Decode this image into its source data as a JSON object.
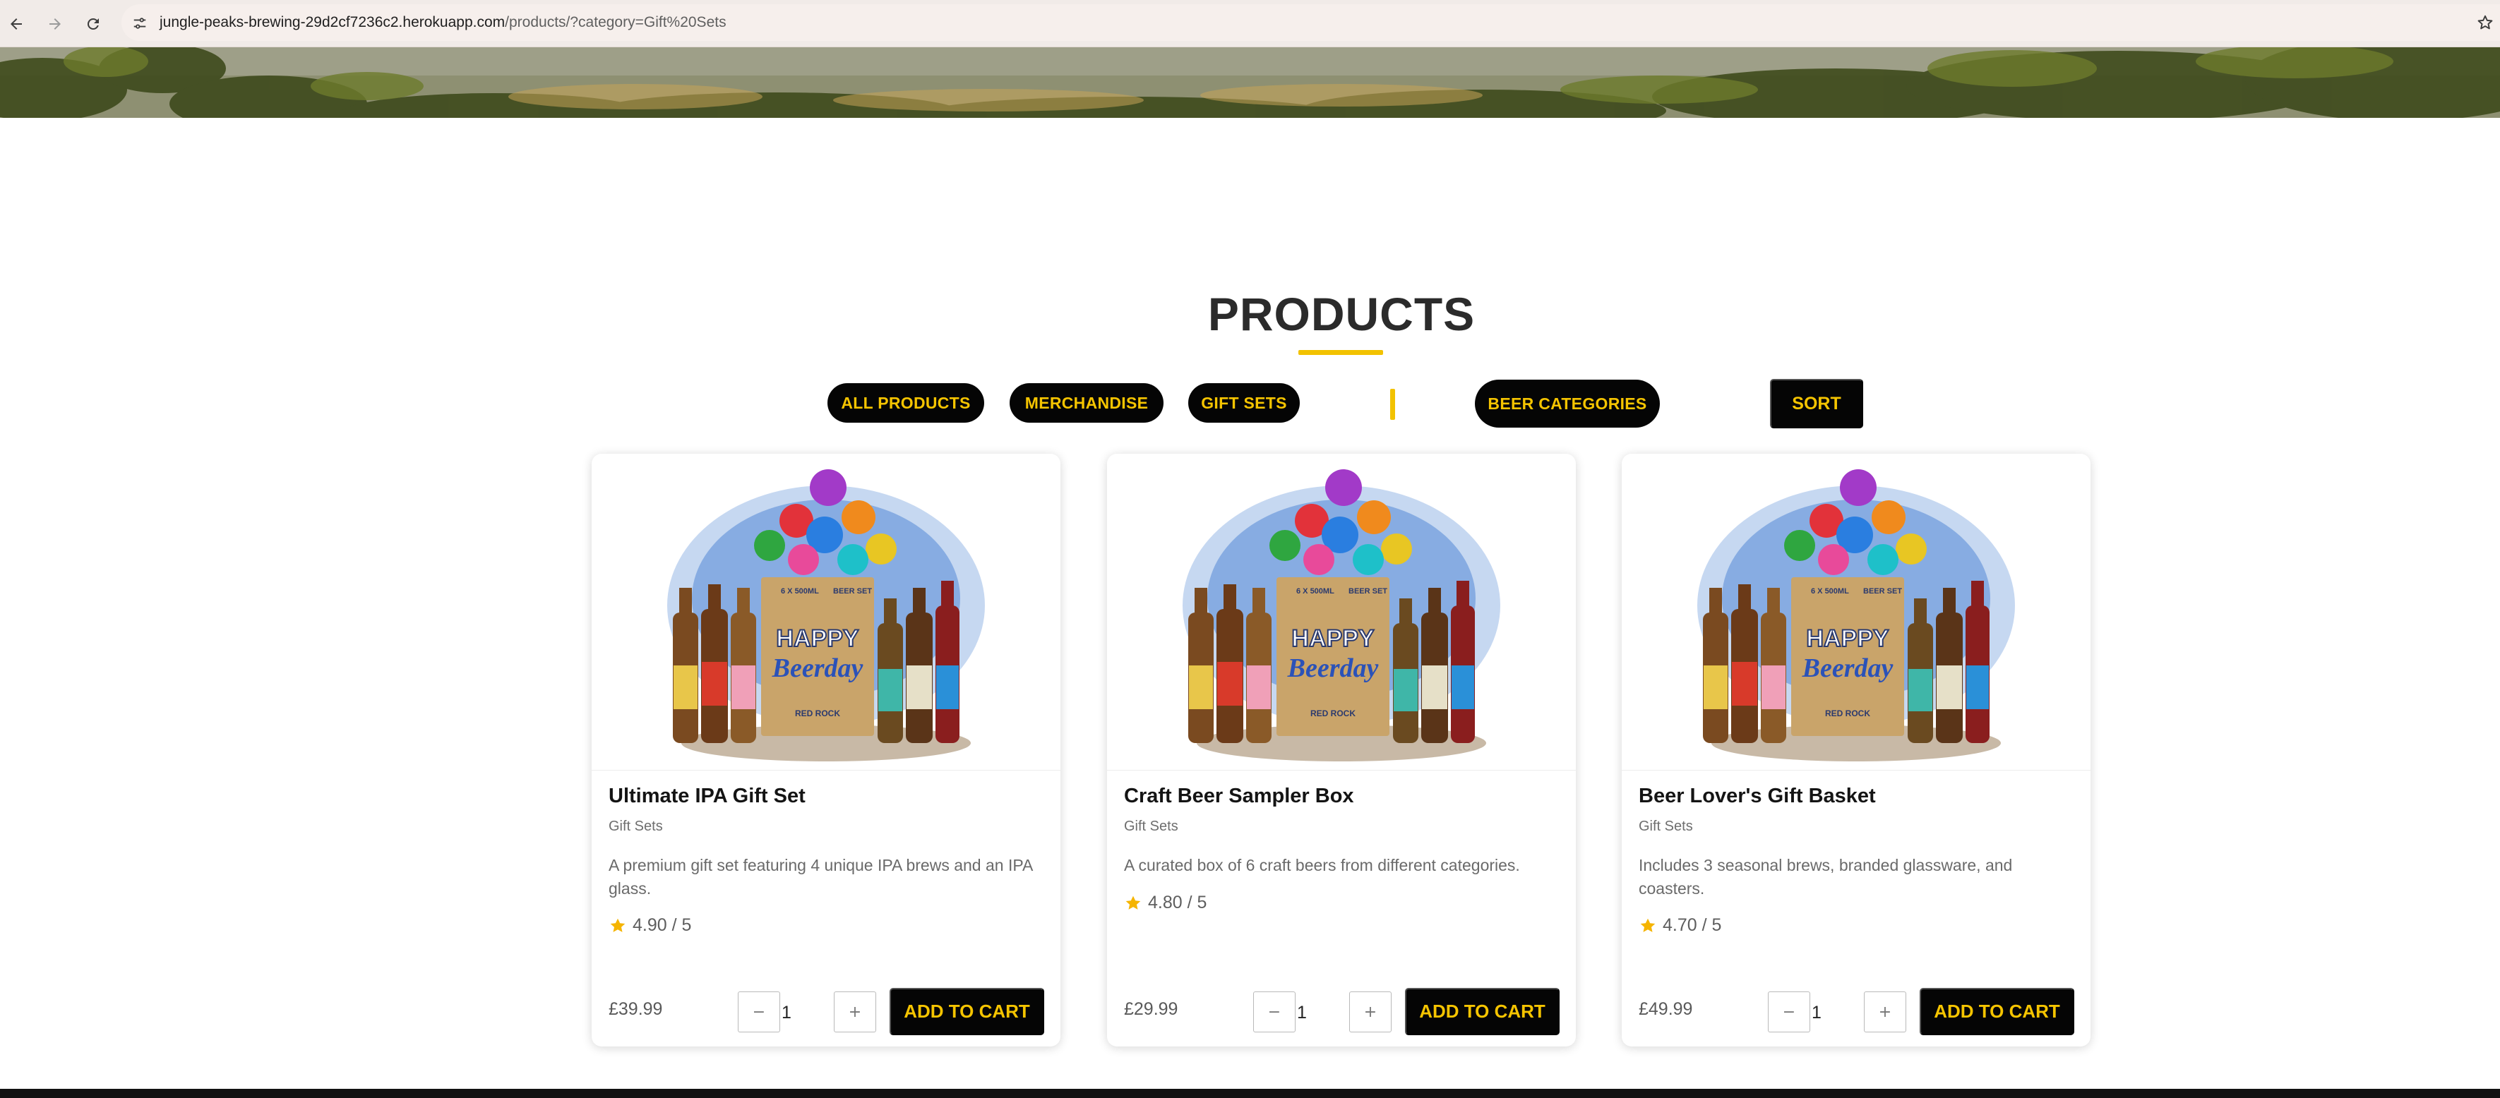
{
  "browser": {
    "url_host": "jungle-peaks-brewing-29d2cf7236c2.herokuapp.com",
    "url_path": "/products/?category=Gift%20Sets"
  },
  "page": {
    "title": "PRODUCTS"
  },
  "filters": {
    "all_products": "ALL PRODUCTS",
    "merchandise": "MERCHANDISE",
    "gift_sets": "GIFT SETS",
    "beer_categories": "BEER CATEGORIES",
    "sort": "SORT"
  },
  "products": [
    {
      "name": "Ultimate IPA Gift Set",
      "category": "Gift Sets",
      "description": "A premium gift set featuring 4 unique IPA brews and an IPA glass.",
      "rating": "4.90 / 5",
      "price": "£39.99",
      "quantity": "1",
      "add_label": "ADD TO CART"
    },
    {
      "name": "Craft Beer Sampler Box",
      "category": "Gift Sets",
      "description": "A curated box of 6 craft beers from different categories.",
      "rating": "4.80 / 5",
      "price": "£29.99",
      "quantity": "1",
      "add_label": "ADD TO CART"
    },
    {
      "name": "Beer Lover's Gift Basket",
      "category": "Gift Sets",
      "description": "Includes 3 seasonal brews, branded glassware, and coasters.",
      "rating": "4.70 / 5",
      "price": "£49.99",
      "quantity": "1",
      "add_label": "ADD TO CART"
    }
  ],
  "product_image_text": {
    "box_top_left": "6 X 500ML",
    "box_top_right": "BEER SET",
    "happy": "HAPPY",
    "beerday": "Beerday",
    "brand": "RED ROCK"
  },
  "colors": {
    "accent_yellow": "#f5c400",
    "button_black": "#050505"
  },
  "icons": {
    "back": "arrow-left-icon",
    "forward": "arrow-right-icon",
    "reload": "reload-icon",
    "site_info": "tune-icon",
    "bookmark": "star-outline-icon",
    "rating": "star-filled-icon"
  }
}
